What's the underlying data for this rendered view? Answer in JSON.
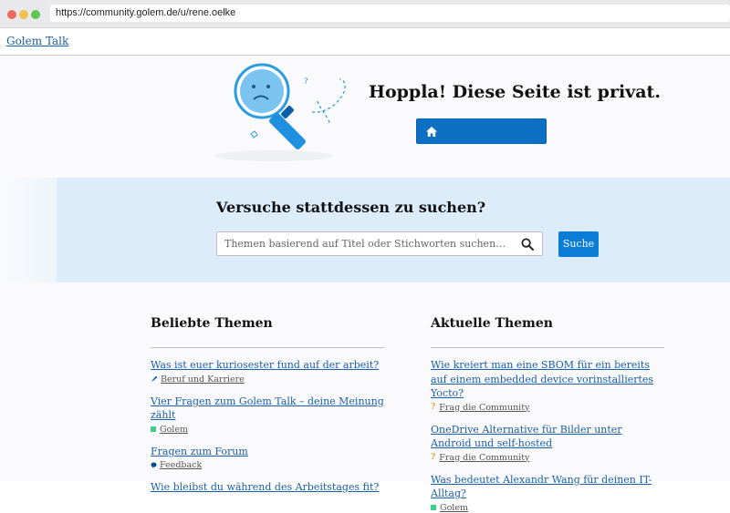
{
  "browser": {
    "url": "https://community.golem.de/u/rene.oelke"
  },
  "header": {
    "site_title": "Golem Talk"
  },
  "error": {
    "title": "Hoppla! Diese Seite ist privat."
  },
  "search": {
    "heading": "Versuche stattdessen zu suchen?",
    "placeholder": "Themen basierend auf Titel oder Stichworten suchen…",
    "button_label": "Suche"
  },
  "popular": {
    "title": "Beliebte Themen",
    "topics": [
      {
        "title": "Was ist euer kuriosester fund auf der arbeit?",
        "category": "Beruf und Karriere",
        "icon": "rocket-icon"
      },
      {
        "title": "Vier Fragen zum Golem Talk – deine Meinung zählt",
        "category": "Golem",
        "icon": "square-icon"
      },
      {
        "title": "Fragen zum Forum",
        "category": "Feedback",
        "icon": "speech-bubble-icon"
      },
      {
        "title": "Wie bleibst du während des Arbeitstages fit?",
        "category": "",
        "icon": ""
      }
    ]
  },
  "latest": {
    "title": "Aktuelle Themen",
    "topics": [
      {
        "title": "Wie kreiert man eine SBOM für ein bereits auf einem embedded device vorinstalliertes Yocto?",
        "category": "Frag die Community",
        "icon": "question-icon"
      },
      {
        "title": "OneDrive Alternative für Bilder unter Android und self-hosted",
        "category": "Frag die Community",
        "icon": "question-icon"
      },
      {
        "title": "Was bedeutet Alexandr Wang für deinen IT-Alltag?",
        "category": "Golem",
        "icon": "square-icon"
      }
    ]
  },
  "colors": {
    "link": "#1a5fa8",
    "primary_button": "#0b6fc4",
    "search_band": "#dcecfb",
    "golem_category": "#3ecf8e",
    "beruf_category": "#0b6fc4",
    "question_category": "#e8a33c"
  }
}
